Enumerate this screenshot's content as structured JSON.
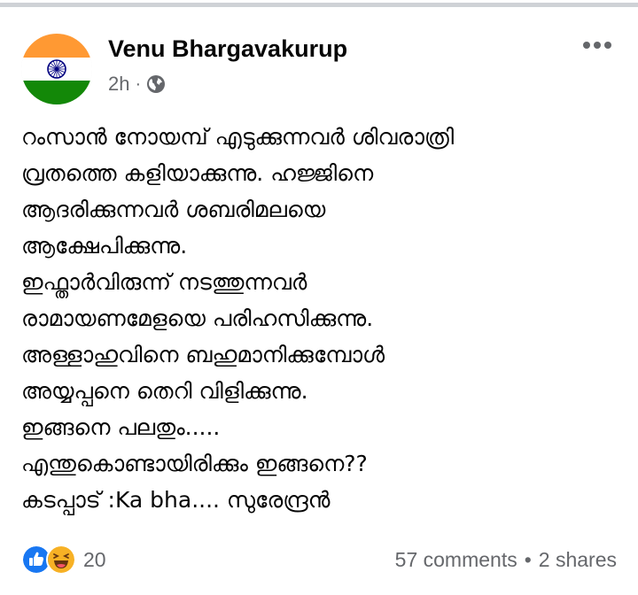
{
  "post": {
    "author_name": "Venu Bhargavakurup",
    "timestamp": "2h",
    "separator": "·",
    "privacy_icon": "globe-icon",
    "more_icon": "more-horizontal-icon",
    "text_lines": [
      "റംസാൻ നോയമ്പ് എടുക്കുന്നവർ ശിവരാത്രി",
      "വ്രതത്തെ കളിയാക്കുന്നു. ഹജ്ജിനെ",
      "ആദരിക്കുന്നവർ ശബരിമലയെ",
      "ആക്ഷേപിക്കുന്നു.",
      "ഇഫ്താർവിരുന്ന് നടത്തുന്നവർ",
      "രാമായണമേളയെ പരിഹസിക്കുന്നു.",
      "അള്ളാഹുവിനെ ബഹുമാനിക്കുമ്പോൾ",
      "അയ്യപ്പനെ തെറി വിളിക്കുന്നു.",
      "ഇങ്ങനെ പലതും.....",
      "എന്തുകൊണ്ടായിരിക്കും ഇങ്ങനെ??",
      "കടപ്പാട് :Ka bha.... സുരേന്ദ്രൻ"
    ]
  },
  "footer": {
    "reaction_icons": [
      "like-reaction-icon",
      "haha-reaction-icon"
    ],
    "reaction_count": "20",
    "comments": "57 comments",
    "stats_separator": "•",
    "shares": "2 shares"
  },
  "colors": {
    "secondary_text": "#65676b",
    "like_blue": "#1877f2",
    "haha_yellow": "#f7b125",
    "divider": "#cfd2d6",
    "saffron": "#ff9933",
    "flag_green": "#138808",
    "chakra_navy": "#000080"
  }
}
